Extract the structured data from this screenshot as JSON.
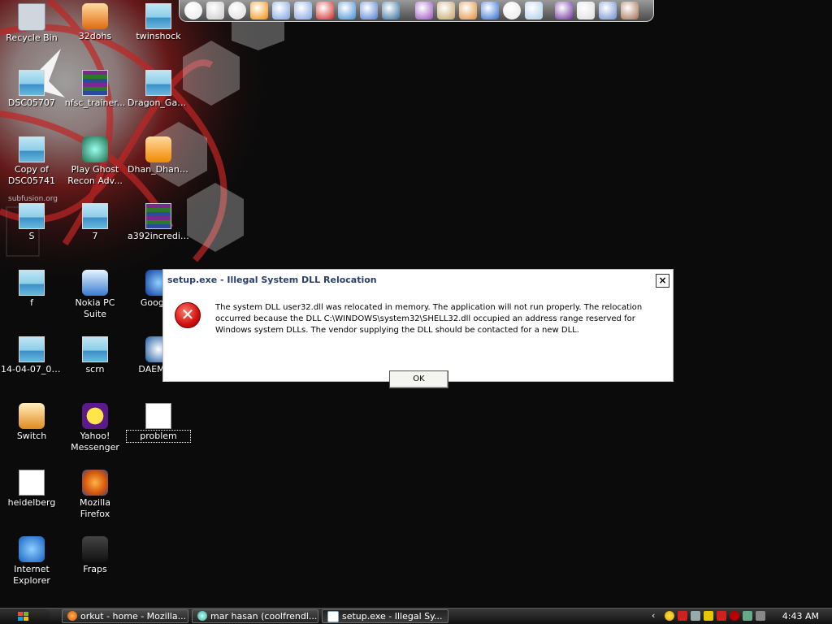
{
  "desktop": {
    "icons": [
      {
        "label": "Recycle Bin",
        "glyph": "recycle-bin-icon"
      },
      {
        "label": "32dohs",
        "glyph": "app-icon"
      },
      {
        "label": "twinshock",
        "glyph": "image-icon"
      },
      {
        "label": "DSC05707",
        "glyph": "image-icon"
      },
      {
        "label": "nfsc_trainer...",
        "glyph": "rar-archive-icon"
      },
      {
        "label": "Dragon_Gam...",
        "glyph": "image-icon"
      },
      {
        "label": "Copy of DSC05741",
        "glyph": "image-icon"
      },
      {
        "label": "Play Ghost Recon Adv...",
        "glyph": "game-shortcut-icon"
      },
      {
        "label": "Dhan_Dhana...",
        "glyph": "media-file-icon"
      },
      {
        "label": "S",
        "glyph": "image-icon"
      },
      {
        "label": "7",
        "glyph": "image-icon"
      },
      {
        "label": "a392incredibl...",
        "glyph": "rar-archive-icon"
      },
      {
        "label": "f",
        "glyph": "image-icon"
      },
      {
        "label": "Nokia PC Suite",
        "glyph": "nokia-pc-suite-icon"
      },
      {
        "label": "Google_",
        "glyph": "google-earth-icon"
      },
      {
        "label": "14-04-07_0806",
        "glyph": "image-icon"
      },
      {
        "label": "scrn",
        "glyph": "image-icon"
      },
      {
        "label": "DAEMON",
        "glyph": "daemon-tools-icon"
      },
      {
        "label": "Switch",
        "glyph": "switch-icon"
      },
      {
        "label": "Yahoo! Messenger",
        "glyph": "yahoo-messenger-icon"
      },
      {
        "label": "problem",
        "glyph": "text-file-icon"
      },
      {
        "label": "heidelberg",
        "glyph": "document-icon"
      },
      {
        "label": "Mozilla Firefox",
        "glyph": "firefox-icon"
      },
      {
        "label": "Internet Explorer",
        "glyph": "internet-explorer-icon"
      },
      {
        "label": "Fraps",
        "glyph": "fraps-icon"
      }
    ],
    "wallpaper_text": "subfusion.org"
  },
  "dock": {
    "items": [
      "clock-icon",
      "drive-icon",
      "cd-icon",
      "vlc-icon",
      "help-icon",
      "help-icon",
      "m-icon",
      "ie-icon",
      "network-icon",
      "nfs-icon",
      "media-icon",
      "nfs2-icon",
      "photo-icon",
      "flash-icon",
      "dvd-icon",
      "display-icon",
      "yahoo-icon",
      "eye-icon",
      "flash2-icon",
      "character-icon"
    ]
  },
  "dialog": {
    "title": "setup.exe - Illegal System DLL Relocation",
    "close_label": "×",
    "icon": "error-icon",
    "message": "The system DLL user32.dll was relocated in memory. The application will not run properly. The relocation occurred because the DLL C:\\WINDOWS\\system32\\SHELL32.dll occupied an address range reserved for Windows system DLLs. The vendor supplying the DLL should be contacted for a new DLL.",
    "ok_label": "OK"
  },
  "taskbar": {
    "start_icon": "windows-flag-icon",
    "tasks": [
      {
        "label": "orkut - home - Mozilla...",
        "icon": "firefox-icon"
      },
      {
        "label": "mar hasan (coolfrendl...",
        "icon": "chat-icon"
      },
      {
        "label": "setup.exe - Illegal Sy...",
        "icon": "window-icon"
      }
    ],
    "tray_icons": [
      "chevron-left-icon",
      "smiley-icon",
      "shield-icon",
      "network-icon",
      "alert-icon",
      "m-icon",
      "security-icon",
      "tool-icon",
      "speaker-icon"
    ],
    "clock": "4:43 AM"
  },
  "colors": {
    "dialog_title": "#2b3f6b",
    "error_red": "#d01010"
  }
}
